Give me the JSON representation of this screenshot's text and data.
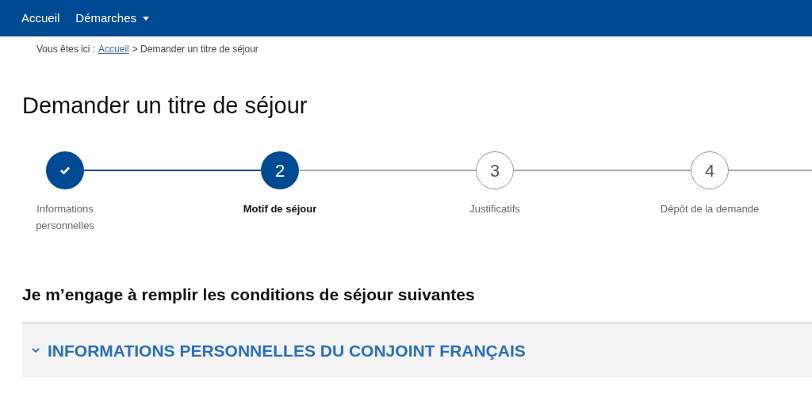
{
  "nav": {
    "items": [
      {
        "label": "Accueil",
        "kind": "link"
      },
      {
        "label": "Démarches",
        "kind": "dropdown"
      }
    ]
  },
  "breadcrumb": {
    "prefix": "Vous êtes ici :",
    "link": "Accueil",
    "current": "> Demander un titre de séjour"
  },
  "title": "Demander un titre de séjour",
  "steps": [
    {
      "kind": "done",
      "label": "Informations personnelles"
    },
    {
      "kind": "current",
      "number": "2",
      "label": "Motif de séjour"
    },
    {
      "kind": "upcoming",
      "number": "3",
      "label": "Justificatifs"
    },
    {
      "kind": "upcoming",
      "number": "4",
      "label": "Dépôt de la demande"
    }
  ],
  "section_title": "Je m’engage à remplir les conditions de séjour suivantes",
  "accordion": {
    "title": "INFORMATIONS PERSONNELLES DU CONJOINT FRANÇAIS",
    "expanded": true
  }
}
